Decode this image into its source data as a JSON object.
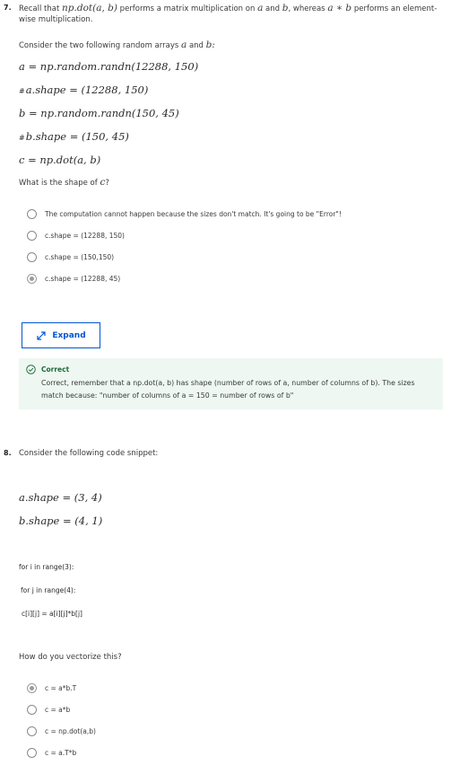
{
  "q7": {
    "number": "7.",
    "recall_prefix": "Recall that",
    "recall_math_1": "np.dot(a, b)",
    "recall_mid": "performs a matrix multiplication on",
    "recall_a": "a",
    "recall_and": "and",
    "recall_b": "b",
    "recall_whereas": ", whereas",
    "recall_math_2": "a ∗ b",
    "recall_suffix": "performs an element-wise",
    "recall_line2": "multiplication.",
    "consider_prefix": "Consider the two following random arrays",
    "consider_a": "a",
    "consider_and": "and",
    "consider_b": "b:",
    "math_lines": [
      "a = np.random.randn(12288, 150)",
      "a.shape = (12288, 150)",
      "b = np.random.randn(150, 45)",
      "b.shape = (150, 45)",
      "c = np.dot(a, b)"
    ],
    "comment_mark": "#",
    "question_prefix": "What is the shape of",
    "question_var": "c",
    "question_suffix": "?",
    "options": [
      "The computation cannot happen because the sizes don't match. It's going to be \"Error\"!",
      "c.shape = (12288, 150)",
      "c.shape = (150,150)",
      "c.shape = (12288, 45)"
    ],
    "selected_index": 3,
    "expand_label": "Expand",
    "feedback_title": "Correct",
    "feedback_body": "Correct, remember that a np.dot(a, b) has shape (number of rows of a, number of columns of b). The sizes match because: \"number of columns of a = 150 = number of rows of b\""
  },
  "q8": {
    "number": "8.",
    "prompt": "Consider the following code snippet:",
    "math_lines": [
      "a.shape = (3, 4)",
      "b.shape = (4, 1)"
    ],
    "code_lines": [
      "for i in range(3):",
      "for j in range(4):",
      "c[i][j] = a[i][j]*b[j]"
    ],
    "question": "How do you vectorize this?",
    "options": [
      "c = a*b.T",
      "c = a*b",
      "c = np.dot(a,b)",
      "c = a.T*b"
    ],
    "selected_index": 0
  },
  "colors": {
    "accent": "#0056d2",
    "success_bg": "#eef7f1",
    "success_text": "#1e6b3b"
  }
}
